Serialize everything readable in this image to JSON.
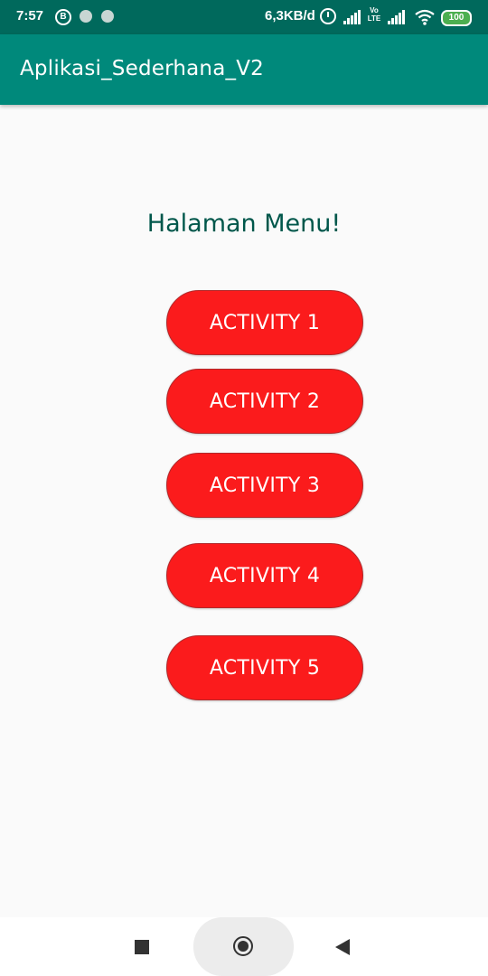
{
  "status_bar": {
    "time": "7:57",
    "b_icon_label": "B",
    "network_speed": "6,3KB/d",
    "volte_label": "Vo LTE",
    "battery_level": "100",
    "colors": {
      "background": "#00695c",
      "battery": "#4caf50"
    }
  },
  "app_bar": {
    "title": "Aplikasi_Sederhana_V2",
    "color": "#00897b"
  },
  "main": {
    "heading": "Halaman Menu!",
    "buttons": [
      {
        "label": "ACTIVITY 1"
      },
      {
        "label": "ACTIVITY 2"
      },
      {
        "label": "ACTIVITY 3"
      },
      {
        "label": "ACTIVITY 4"
      },
      {
        "label": "ACTIVITY 5"
      }
    ],
    "button_color": "#fb1b1c",
    "heading_color": "#00574b"
  },
  "nav_bar": {
    "icons": [
      "recents-square-icon",
      "home-circle-icon",
      "back-triangle-icon"
    ]
  }
}
